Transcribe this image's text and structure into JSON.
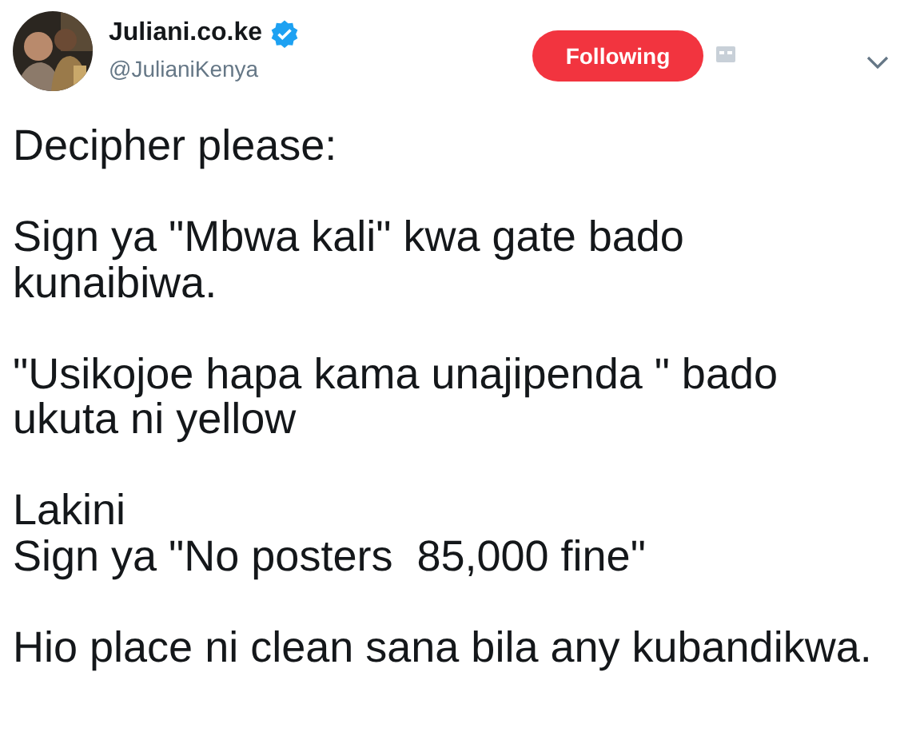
{
  "author": {
    "name": "Juliani.co.ke",
    "verified": true,
    "handle": "@JulianiKenya"
  },
  "follow_button": {
    "label": "Following",
    "selected": true
  },
  "paragraphs": [
    [
      "Decipher please:"
    ],
    [
      "Sign ya \"Mbwa kali\" kwa gate bado",
      "kunaibiwa."
    ],
    [
      "\"Usikojoe hapa kama unajipenda \" bado",
      "ukuta ni yellow"
    ],
    [
      "Lakini",
      "Sign ya \"No posters  85,000 fine\""
    ],
    [
      "Hio place ni clean sana bila any kubandikwa."
    ]
  ]
}
